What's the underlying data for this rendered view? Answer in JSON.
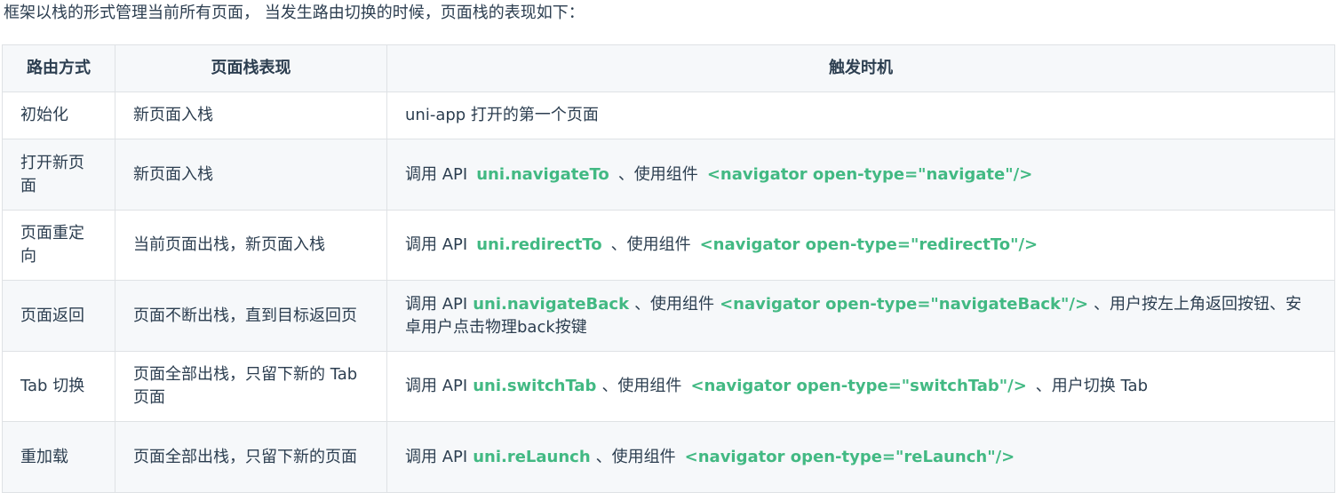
{
  "intro": "框架以栈的形式管理当前所有页面， 当发生路由切换的时候，页面栈的表现如下：",
  "table": {
    "headers": [
      "路由方式",
      "页面栈表现",
      "触发时机"
    ],
    "rows": [
      {
        "method": "初始化",
        "stack": "新页面入栈",
        "trigger": {
          "text1": "uni-app 打开的第一个页面"
        }
      },
      {
        "method": "打开新页面",
        "stack": "新页面入栈",
        "trigger": {
          "pre": "调用 API",
          "api": "uni.navigateTo",
          "mid": "、使用组件",
          "component": "<navigator open-type=\"navigate\"/>"
        }
      },
      {
        "method": "页面重定向",
        "stack": "当前页面出栈，新页面入栈",
        "trigger": {
          "pre": "调用 API",
          "api": "uni.redirectTo",
          "mid": "、使用组件",
          "component": "<navigator open-type=\"redirectTo\"/>"
        }
      },
      {
        "method": "页面返回",
        "stack": "页面不断出栈，直到目标返回页",
        "trigger": {
          "pre": "调用 API",
          "api": "uni.navigateBack",
          "mid": "、使用组件",
          "component": "<navigator open-type=\"navigateBack\"/>",
          "post": "、用户按左上角返回按钮、安卓用户点击物理back按键"
        }
      },
      {
        "method": "Tab 切换",
        "stack": "页面全部出栈，只留下新的 Tab 页面",
        "trigger": {
          "pre": "调用 API",
          "api": "uni.switchTab",
          "mid": "、使用组件",
          "component": "<navigator open-type=\"switchTab\"/>",
          "post": "、用户切换 Tab"
        }
      },
      {
        "method": "重加载",
        "stack": "页面全部出栈，只留下新的页面",
        "trigger": {
          "pre": "调用 API",
          "api": "uni.reLaunch",
          "mid": "、使用组件",
          "component": "<navigator open-type=\"reLaunch\"/>"
        }
      }
    ]
  }
}
